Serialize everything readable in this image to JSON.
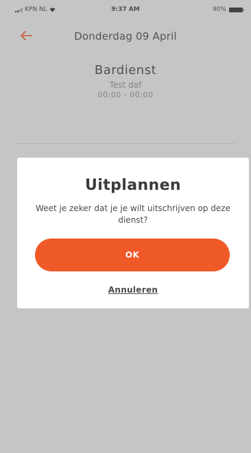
{
  "status_bar": {
    "carrier": "KPN NL",
    "time": "9:37 AM",
    "battery": "90%",
    "icons": [
      "signal-icon",
      "wifi-icon",
      "battery-icon"
    ]
  },
  "header": {
    "back_icon": "back-arrow-icon",
    "title": "Donderdag 09 April"
  },
  "shift": {
    "title": "Bardienst",
    "subtitle": "Test daf",
    "time": "00:00 - 00:00"
  },
  "dialog": {
    "title": "Uitplannen",
    "message": "Weet je zeker dat je je wilt uitschrijven op deze dienst?",
    "ok_label": "OK",
    "cancel_label": "Annuleren"
  },
  "colors": {
    "accent": "#f05a28",
    "overlay": "rgba(120,120,120,0.38)",
    "text": "#3b3b3b"
  }
}
